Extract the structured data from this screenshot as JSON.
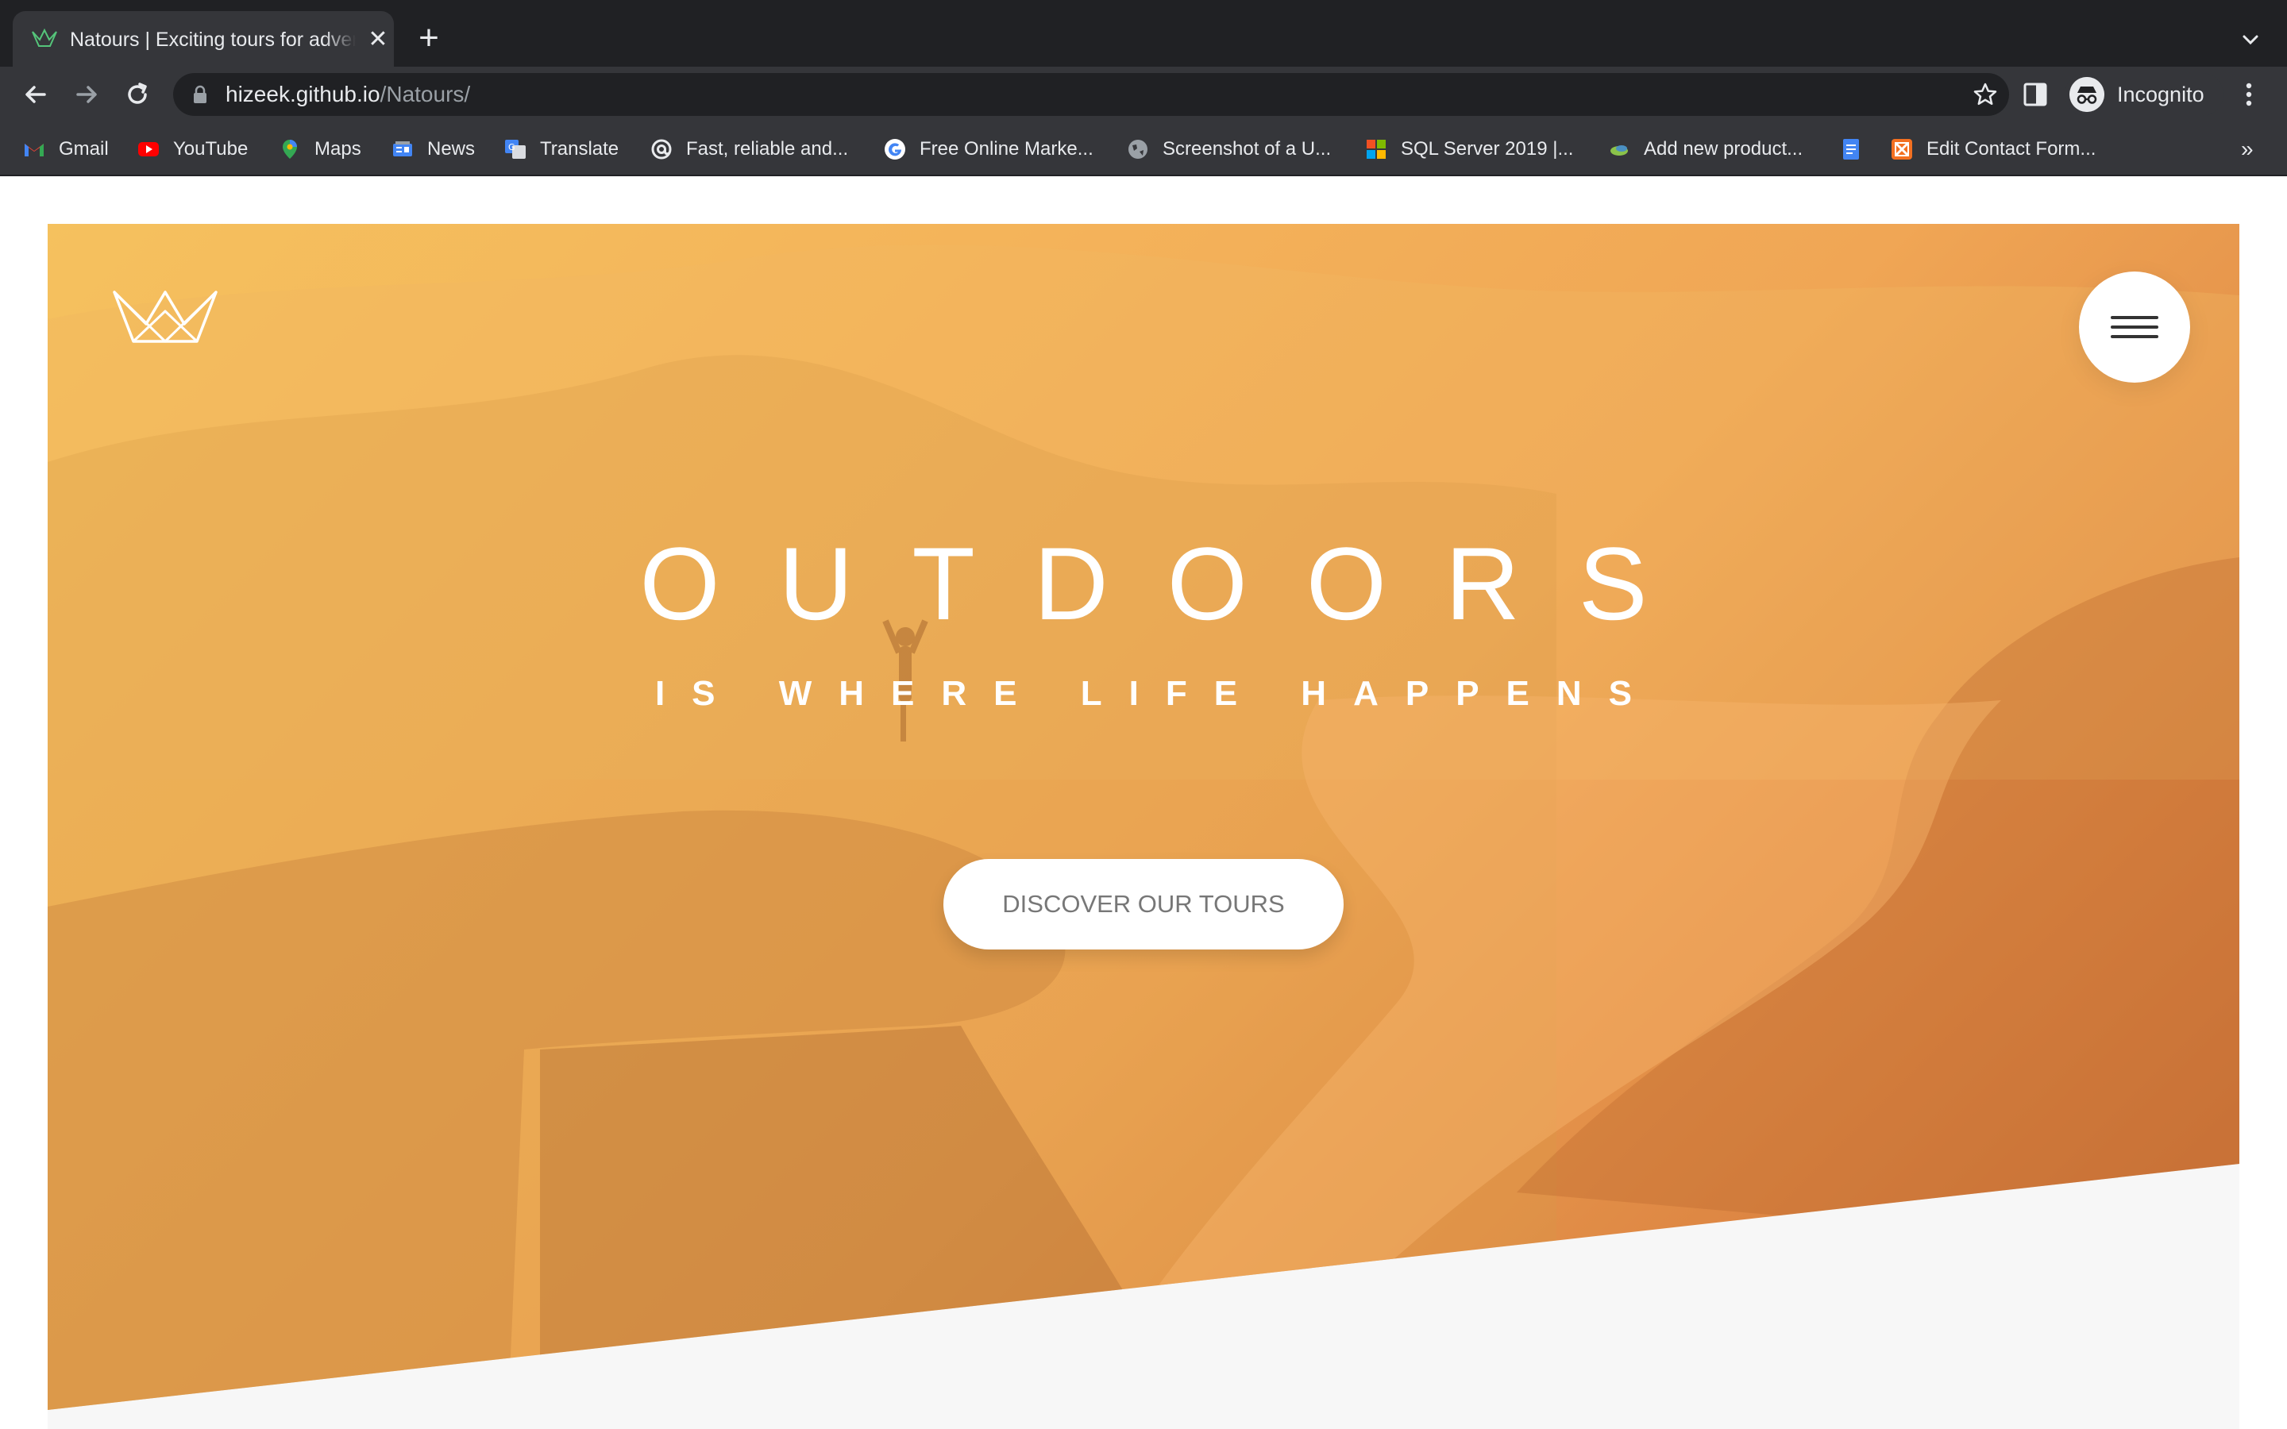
{
  "browser": {
    "tab": {
      "title": "Natours | Exciting tours for adventurous people",
      "close_glyph": "✕",
      "favicon": "crown-icon"
    },
    "new_tab_glyph": "+",
    "address": {
      "host": "hizeek.github.io",
      "path": "/Natours/"
    },
    "profile_label": "Incognito",
    "bookmarks": [
      {
        "label": "Gmail",
        "icon": "gmail-icon"
      },
      {
        "label": "YouTube",
        "icon": "youtube-icon"
      },
      {
        "label": "Maps",
        "icon": "maps-icon"
      },
      {
        "label": "News",
        "icon": "news-icon"
      },
      {
        "label": "Translate",
        "icon": "translate-icon"
      },
      {
        "label": "Fast, reliable and...",
        "icon": "at-icon"
      },
      {
        "label": "Free Online Marke...",
        "icon": "google-icon"
      },
      {
        "label": "Screenshot of a U...",
        "icon": "globe-icon"
      },
      {
        "label": "SQL Server 2019 |...",
        "icon": "microsoft-icon"
      },
      {
        "label": "Add new product...",
        "icon": "bird-icon"
      },
      {
        "label": "",
        "icon": "docs-icon"
      },
      {
        "label": "Edit Contact Form...",
        "icon": "form-icon"
      }
    ],
    "bookmarks_overflow": "»"
  },
  "page": {
    "heading_main": "OUTDOORS",
    "heading_sub": "IS WHERE LIFE HAPPENS",
    "cta_label": "DISCOVER OUR TOURS"
  },
  "colors": {
    "hero_start": "#f5c15e",
    "hero_end": "#c96f38",
    "chrome_dark": "#202124",
    "chrome_toolbar": "#35363a"
  }
}
